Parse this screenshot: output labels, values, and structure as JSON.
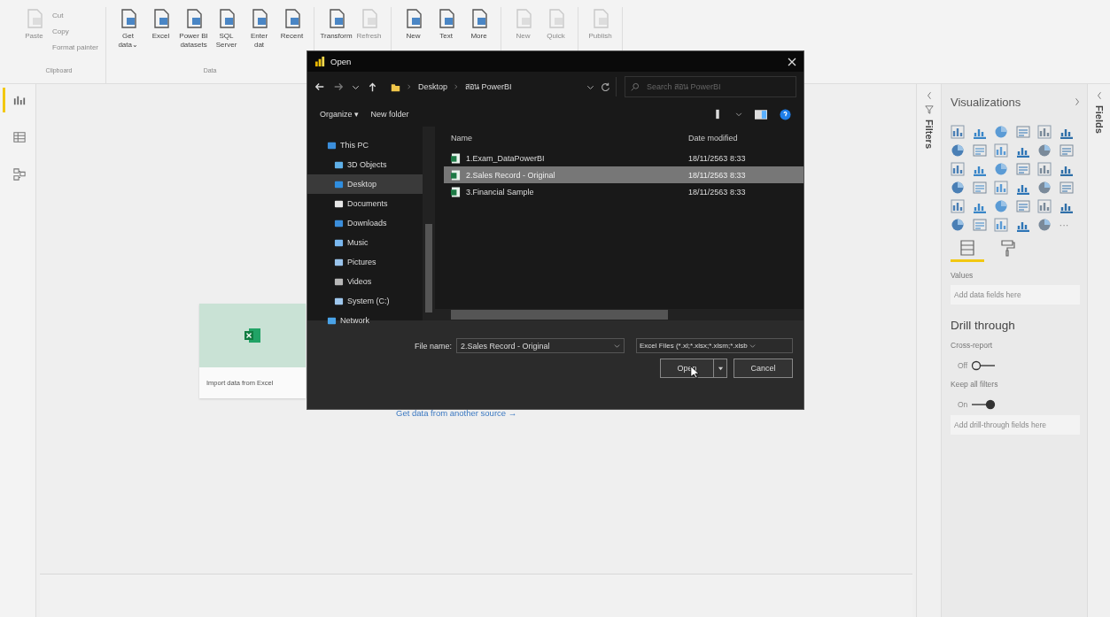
{
  "ribbon": {
    "groups": [
      {
        "label": "Clipboard",
        "buttons": [
          {
            "kind": "large",
            "lines": [
              "Paste"
            ],
            "disabled": true
          },
          {
            "kind": "small",
            "lines": [
              "Cut"
            ],
            "disabled": true
          },
          {
            "kind": "small",
            "lines": [
              "Copy"
            ],
            "disabled": true
          },
          {
            "kind": "small",
            "lines": [
              "Format painter"
            ],
            "disabled": true
          }
        ]
      },
      {
        "label": "Data",
        "buttons": [
          {
            "kind": "large",
            "lines": [
              "Get",
              "data⌄"
            ],
            "disabled": false
          },
          {
            "kind": "large",
            "lines": [
              "Excel"
            ],
            "disabled": false
          },
          {
            "kind": "large",
            "lines": [
              "Power BI",
              "datasets"
            ],
            "disabled": false
          },
          {
            "kind": "large",
            "lines": [
              "SQL",
              "Server"
            ],
            "disabled": false
          },
          {
            "kind": "large",
            "lines": [
              "Enter",
              "dat"
            ],
            "disabled": false
          },
          {
            "kind": "large",
            "lines": [
              "Recent"
            ],
            "disabled": false
          }
        ]
      },
      {
        "buttons": [
          {
            "kind": "large",
            "lines": [
              "Transform"
            ],
            "disabled": false
          },
          {
            "kind": "large",
            "lines": [
              "Refresh"
            ],
            "disabled": true
          }
        ]
      },
      {
        "buttons": [
          {
            "kind": "large",
            "lines": [
              "New"
            ],
            "disabled": false
          },
          {
            "kind": "large",
            "lines": [
              "Text"
            ],
            "disabled": false
          },
          {
            "kind": "large",
            "lines": [
              "More"
            ],
            "disabled": false
          }
        ]
      },
      {
        "buttons": [
          {
            "kind": "large",
            "lines": [
              "New"
            ],
            "disabled": true
          },
          {
            "kind": "large",
            "lines": [
              "Quick"
            ],
            "disabled": true
          }
        ]
      },
      {
        "buttons": [
          {
            "kind": "large",
            "lines": [
              "Publish"
            ],
            "disabled": true
          }
        ]
      }
    ]
  },
  "left_rail": [
    {
      "kind": "report",
      "selected": true
    },
    {
      "kind": "data",
      "selected": false
    },
    {
      "kind": "model",
      "selected": false
    }
  ],
  "canvas": {
    "excel_card": {
      "label": "Import data from Excel"
    },
    "link": "Get data from another source →"
  },
  "filters_pane": {
    "title": "Filters"
  },
  "visualizations": {
    "title": "Visualizations",
    "more_visuals": "···",
    "tabs": [
      {
        "kind": "fields",
        "selected": true
      },
      {
        "kind": "format",
        "selected": false
      }
    ],
    "values_label": "Values",
    "values_well": "Add data fields here",
    "drill_title": "Drill through",
    "toggles": [
      {
        "label": "Cross-report",
        "state_text": "Off",
        "on": false
      },
      {
        "label": "Keep all filters",
        "state_text": "On",
        "on": true
      }
    ],
    "drill_well": "Add drill-through fields here"
  },
  "fields_pane": {
    "title": "Fields"
  },
  "dialog": {
    "title": "Open",
    "breadcrumb": [
      "Desktop",
      "สอน PowerBI"
    ],
    "search_placeholder": "Search สอน PowerBI",
    "organize": "Organize ▾",
    "new_folder": "New folder",
    "nav": [
      {
        "label": "This PC",
        "kind": "pc",
        "selected": false,
        "children": [
          {
            "label": "3D Objects",
            "kind": "cube",
            "selected": false
          },
          {
            "label": "Desktop",
            "kind": "desktop",
            "selected": true
          },
          {
            "label": "Documents",
            "kind": "doc",
            "selected": false
          },
          {
            "label": "Downloads",
            "kind": "download",
            "selected": false
          },
          {
            "label": "Music",
            "kind": "music",
            "selected": false
          },
          {
            "label": "Pictures",
            "kind": "picture",
            "selected": false
          },
          {
            "label": "Videos",
            "kind": "video",
            "selected": false
          },
          {
            "label": "System (C:)",
            "kind": "drive",
            "selected": false
          }
        ]
      },
      {
        "label": "Network",
        "kind": "network",
        "selected": false
      }
    ],
    "columns": [
      "Name",
      "Date modified"
    ],
    "files": [
      {
        "name": "1.Exam_DataPowerBI",
        "date": "18/11/2563 8:33",
        "selected": false
      },
      {
        "name": "2.Sales Record - Original",
        "date": "18/11/2563 8:33",
        "selected": true
      },
      {
        "name": "3.Financial Sample",
        "date": "18/11/2563 8:33",
        "selected": false
      }
    ],
    "file_name_label": "File name:",
    "file_name": "2.Sales Record - Original",
    "file_type": "Excel Files (*.xl;*.xlsx;*.xlsm;*.xlsb",
    "open": "Open",
    "cancel": "Cancel"
  }
}
